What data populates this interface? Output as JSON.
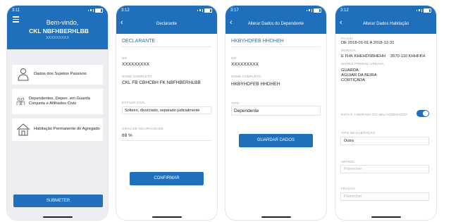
{
  "colors": {
    "brand": "#1f6fbd",
    "background": "#eceef1"
  },
  "screen1": {
    "time": "3:11",
    "welcome": "Bem-vindo,",
    "user_name": "CKL NBFHBERHLBB",
    "user_number": "XXXXXXXXX",
    "cards": [
      {
        "label": "Dados dos Sujeitos Passivos",
        "icon": "user-icon"
      },
      {
        "label": "Dependentes, Depen. em Guarda Conjunta e Afilhados Civis",
        "icon": "family-icon"
      },
      {
        "label": "Habitação Permanente do Agregado",
        "icon": "house-icon"
      }
    ],
    "submit_label": "SUBMETER"
  },
  "screen2": {
    "time": "3:12",
    "title": "Declarante",
    "section": "DECLARANTE",
    "nif_label": "NIF",
    "nif_value": "XXXXXXXXX",
    "name_label": "NOME COMPLETO",
    "name_value": "CKL FB CBHCBH FK NBFHBERHLBB",
    "civil_label": "ESTADO CIVIL",
    "civil_value": "Solteiro, divorciado, separado judicialmente",
    "disability_label": "GRAU DE INCAPACIDADE",
    "disability_value": "69 %",
    "confirm_label": "CONFIRMAR"
  },
  "screen3": {
    "time": "3:17",
    "title": "Alterar Dados do Dependente",
    "section": "HKBYHDFEB HHDHEH",
    "nif_label": "NIF",
    "nif_value": "XXXXXXXXX",
    "name_label": "NOME COMPLETO",
    "name_value": "HKBYHDFEB HHDHEH",
    "type_label": "TIPO",
    "type_value": "Dependente",
    "save_label": "GUARDAR DADOS"
  },
  "screen4": {
    "time": "3:12",
    "title": "Alterar Dados Habitação",
    "period_label": "Período",
    "period_value": "DE 2018-01-01 A 2018-12-31",
    "address_label": "MORADA",
    "address_line1": "E FHK KHEHDSBHEHH",
    "address_postal": "3570-110 KHHFKH",
    "urban_label": "MATRIZ PREDIAL URBANA",
    "urban_lines": [
      "GUARDA",
      "AGUIAR DA BEIRA",
      "CORTIÇADA"
    ],
    "toggle_label": "ESTA É A MORADA DO SEU AGREGADO?",
    "toggle_on": true,
    "habitation_type_label": "TIPO DE HABITAÇÃO",
    "habitation_type_value": "Outra",
    "article_label": "ARTIGO",
    "article_placeholder": "Preencher",
    "fraction_label": "FRAÇÃO",
    "fraction_placeholder": "Preencher"
  }
}
